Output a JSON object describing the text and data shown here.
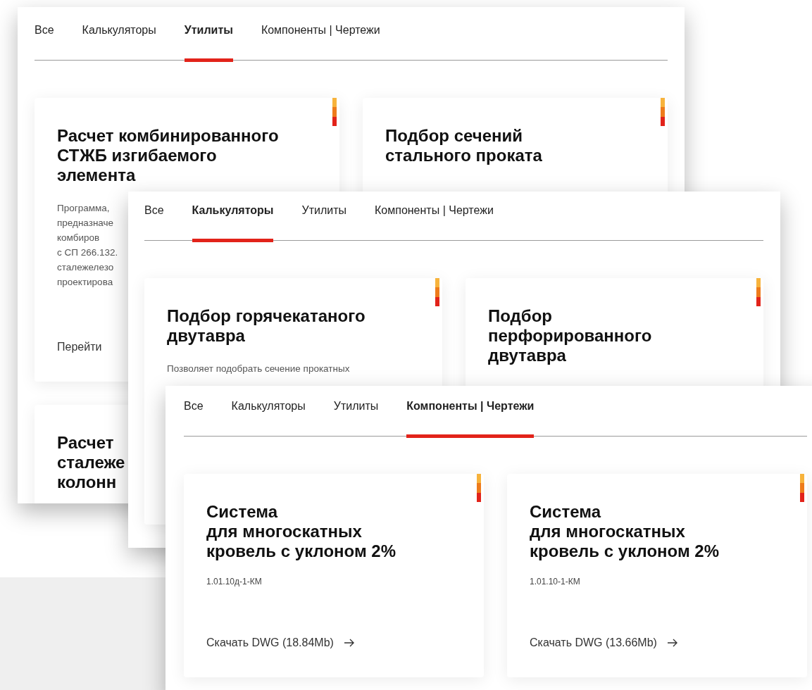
{
  "windows": [
    {
      "tabs": [
        {
          "label": "Все",
          "selected": false
        },
        {
          "label": "Калькуляторы",
          "selected": false
        },
        {
          "label": "Утилиты",
          "selected": true
        },
        {
          "label": "Компоненты | Чертежи",
          "selected": false
        }
      ],
      "cards": [
        {
          "accent": true,
          "title": "Расчет комбинированного\nСТЖБ изгибаемого\nэлемента",
          "description": "Программа,\nпредназначе\nкомбиров\nс СП 266.132.\nсталежелезо\nпроектирова",
          "link": {
            "label": "Перейти",
            "arrow": false
          }
        },
        {
          "accent": true,
          "title": "Подбор сечений\nстального проката"
        },
        {
          "title": "Расчет\nсталеже\nколонн"
        }
      ]
    },
    {
      "tabs": [
        {
          "label": "Все",
          "selected": false
        },
        {
          "label": "Калькуляторы",
          "selected": true
        },
        {
          "label": "Утилиты",
          "selected": false
        },
        {
          "label": "Компоненты | Чертежи",
          "selected": false
        }
      ],
      "cards": [
        {
          "accent": true,
          "title": "Подбор горячекатаного\nдвутавра",
          "description": "Позволяет подобрать сечение прокатных"
        },
        {
          "accent": true,
          "title": "Подбор\nперфорированного\nдвутавра"
        }
      ]
    },
    {
      "tabs": [
        {
          "label": "Все",
          "selected": false
        },
        {
          "label": "Калькуляторы",
          "selected": false
        },
        {
          "label": "Утилиты",
          "selected": false
        },
        {
          "label": "Компоненты | Чертежи",
          "selected": true
        }
      ],
      "cards": [
        {
          "accent": true,
          "title": "Система\nдля многоскатных\nкровель с уклоном 2%",
          "code": "1.01.10д-1-КМ",
          "link": {
            "label": "Скачать DWG (18.84Mb)",
            "arrow": true
          }
        },
        {
          "accent": true,
          "title": "Система\nдля многоскатных\nкровель с уклоном 2%",
          "code": "1.01.10-1-КМ",
          "link": {
            "label": "Скачать DWG (13.66Mb)",
            "arrow": true
          }
        }
      ]
    }
  ]
}
